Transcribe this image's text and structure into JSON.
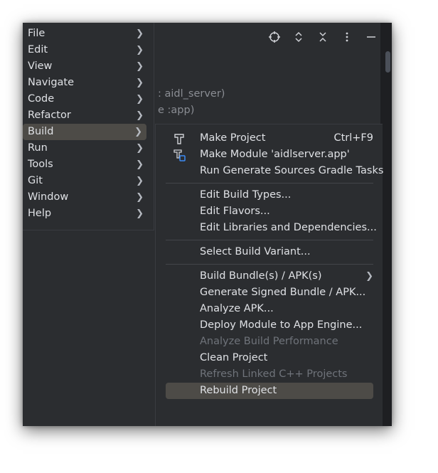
{
  "main_menu": {
    "items": [
      {
        "label": "File"
      },
      {
        "label": "Edit"
      },
      {
        "label": "View"
      },
      {
        "label": "Navigate"
      },
      {
        "label": "Code"
      },
      {
        "label": "Refactor"
      },
      {
        "label": "Build"
      },
      {
        "label": "Run"
      },
      {
        "label": "Tools"
      },
      {
        "label": "Git"
      },
      {
        "label": "Window"
      },
      {
        "label": "Help"
      }
    ],
    "active": "Build"
  },
  "background": {
    "line1": ": aidl_server)",
    "line2": "e :app)"
  },
  "build_menu": {
    "make_project": {
      "label": "Make Project",
      "shortcut": "Ctrl+F9"
    },
    "make_module": {
      "label": "Make Module 'aidlserver.app'"
    },
    "run_generate": {
      "label": "Run Generate Sources Gradle Tasks"
    },
    "edit_build_types": {
      "label": "Edit Build Types..."
    },
    "edit_flavors": {
      "label": "Edit Flavors..."
    },
    "edit_libraries": {
      "label": "Edit Libraries and Dependencies..."
    },
    "select_variant": {
      "label": "Select Build Variant..."
    },
    "build_bundle": {
      "label": "Build Bundle(s) / APK(s)"
    },
    "generate_signed": {
      "label": "Generate Signed Bundle / APK..."
    },
    "analyze_apk": {
      "label": "Analyze APK..."
    },
    "deploy_module": {
      "label": "Deploy Module to App Engine..."
    },
    "analyze_build_perf": {
      "label": "Analyze Build Performance"
    },
    "clean_project": {
      "label": "Clean Project"
    },
    "refresh_cpp": {
      "label": "Refresh Linked C++ Projects"
    },
    "rebuild_project": {
      "label": "Rebuild Project"
    }
  },
  "icons": {
    "toolbar": [
      "crosshair-icon",
      "expand-icon",
      "collapse-icon",
      "more-vertical-icon",
      "minimize-icon"
    ],
    "make_project": "hammer-icon",
    "make_module": "hammer-module-icon"
  },
  "colors": {
    "menu_bg": "#2b2d30",
    "highlight": "#4d4b47",
    "text": "#dfe1e5",
    "disabled": "#6f737a"
  }
}
